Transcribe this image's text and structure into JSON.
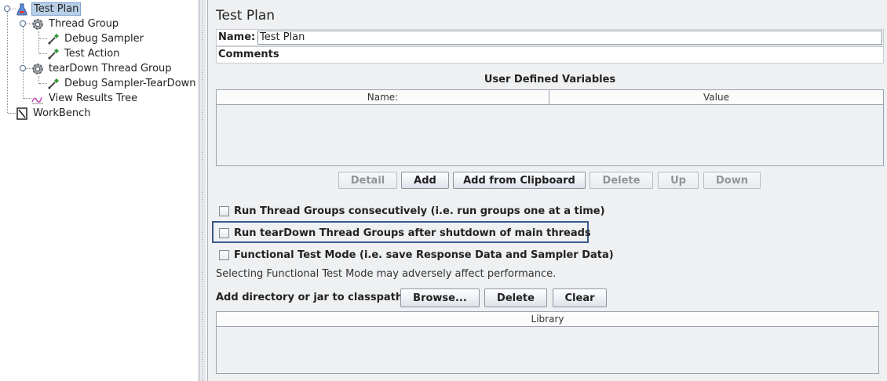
{
  "tree": {
    "items": [
      {
        "label": "Test Plan",
        "icon": "flask-icon"
      },
      {
        "label": "Thread Group",
        "icon": "gear-icon"
      },
      {
        "label": "Debug Sampler",
        "icon": "pipette-icon"
      },
      {
        "label": "Test Action",
        "icon": "pipette-icon"
      },
      {
        "label": "tearDown Thread Group",
        "icon": "gear-icon"
      },
      {
        "label": "Debug Sampler-TearDown",
        "icon": "pipette-icon"
      },
      {
        "label": "View Results Tree",
        "icon": "graph-icon"
      },
      {
        "label": "WorkBench",
        "icon": "workbench-icon"
      }
    ]
  },
  "panel": {
    "title": "Test Plan",
    "name_label": "Name:",
    "name_value": "Test Plan",
    "comments_label": "Comments:",
    "comments_value": "",
    "udv": {
      "title": "User Defined Variables",
      "columns": [
        "Name:",
        "Value"
      ]
    },
    "buttons": {
      "detail": "Detail",
      "add": "Add",
      "add_clipboard": "Add from Clipboard",
      "delete": "Delete",
      "up": "Up",
      "down": "Down"
    },
    "checkboxes": [
      {
        "label": "Run Thread Groups consecutively (i.e. run groups one at a time)",
        "checked": false
      },
      {
        "label": "Run tearDown Thread Groups after shutdown of main threads",
        "checked": false
      },
      {
        "label": "Functional Test Mode (i.e. save Response Data and Sampler Data)",
        "checked": false
      }
    ],
    "note": "Selecting Functional Test Mode may adversely affect performance.",
    "classpath": {
      "label": "Add directory or jar to classpath",
      "browse": "Browse...",
      "delete": "Delete",
      "clear": "Clear",
      "library_header": "Library"
    }
  },
  "colors": {
    "selection": "#b8cfe5",
    "focus_border": "#3c5a8c",
    "panel_bg": "#eef0f2"
  }
}
